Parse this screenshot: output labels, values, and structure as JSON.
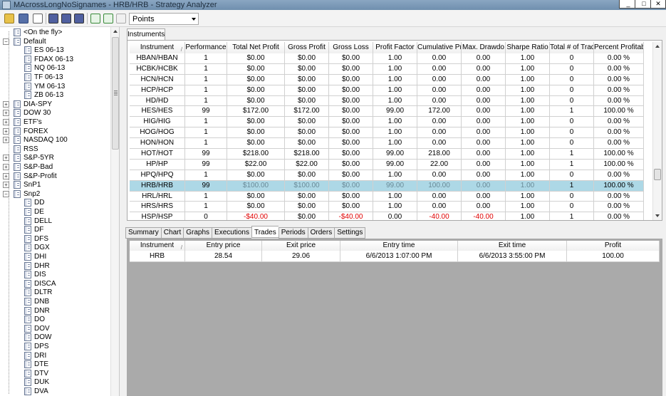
{
  "window": {
    "title": "MAcrossLongNoSignames - HRB/HRB - Strategy Analyzer",
    "minimize": "_",
    "maximize": "□",
    "close": "✕"
  },
  "toolbar": {
    "buttons": [
      "open-icon",
      "save-icon",
      "chat-icon",
      "backtest-icon",
      "optimize-icon",
      "walkforward-icon",
      "add-icon",
      "edit-icon",
      "remove-icon"
    ],
    "display_unit": "Points"
  },
  "tree": {
    "items": [
      {
        "label": "<On the fly>",
        "level": 1
      },
      {
        "label": "Default",
        "level": 0,
        "expander": "−"
      },
      {
        "label": "ES 06-13",
        "level": 2
      },
      {
        "label": "FDAX 06-13",
        "level": 2
      },
      {
        "label": "NQ 06-13",
        "level": 2
      },
      {
        "label": "TF 06-13",
        "level": 2
      },
      {
        "label": "YM 06-13",
        "level": 2
      },
      {
        "label": "ZB 06-13",
        "level": 2
      },
      {
        "label": "DIA-SPY",
        "level": 0,
        "expander": "+"
      },
      {
        "label": "DOW 30",
        "level": 0,
        "expander": "+"
      },
      {
        "label": "ETF's",
        "level": 0,
        "expander": "+"
      },
      {
        "label": "FOREX",
        "level": 0,
        "expander": "+"
      },
      {
        "label": "NASDAQ 100",
        "level": 0,
        "expander": "+"
      },
      {
        "label": "RSS",
        "level": 1
      },
      {
        "label": "S&P-5YR",
        "level": 0,
        "expander": "+"
      },
      {
        "label": "S&P-Bad",
        "level": 0,
        "expander": "+"
      },
      {
        "label": "S&P-Profit",
        "level": 0,
        "expander": "+"
      },
      {
        "label": "SnP1",
        "level": 0,
        "expander": "+"
      },
      {
        "label": "Snp2",
        "level": 0,
        "expander": "−"
      },
      {
        "label": "DD",
        "level": 2
      },
      {
        "label": "DE",
        "level": 2
      },
      {
        "label": "DELL",
        "level": 2
      },
      {
        "label": "DF",
        "level": 2
      },
      {
        "label": "DFS",
        "level": 2
      },
      {
        "label": "DGX",
        "level": 2
      },
      {
        "label": "DHI",
        "level": 2
      },
      {
        "label": "DHR",
        "level": 2
      },
      {
        "label": "DIS",
        "level": 2
      },
      {
        "label": "DISCA",
        "level": 2
      },
      {
        "label": "DLTR",
        "level": 2
      },
      {
        "label": "DNB",
        "level": 2
      },
      {
        "label": "DNR",
        "level": 2
      },
      {
        "label": "DO",
        "level": 2
      },
      {
        "label": "DOV",
        "level": 2
      },
      {
        "label": "DOW",
        "level": 2
      },
      {
        "label": "DPS",
        "level": 2
      },
      {
        "label": "DRI",
        "level": 2
      },
      {
        "label": "DTE",
        "level": 2
      },
      {
        "label": "DTV",
        "level": 2
      },
      {
        "label": "DUK",
        "level": 2
      },
      {
        "label": "DVA",
        "level": 2
      }
    ]
  },
  "instruments_tab": "Instruments",
  "grid": {
    "columns": [
      "Instrument",
      "Performance",
      "Total Net Profit",
      "Gross Profit",
      "Gross Loss",
      "Profit Factor",
      "Cumulative Pr",
      "Max. Drawdo",
      "Sharpe Ratio",
      "Total # of Trad",
      "Percent Profitabl"
    ],
    "sort_indicator": "/",
    "rows": [
      [
        "HBAN/HBAN",
        "1",
        "$0.00",
        "$0.00",
        "$0.00",
        "1.00",
        "0.00",
        "0.00",
        "1.00",
        "0",
        "0.00 %"
      ],
      [
        "HCBK/HCBK",
        "1",
        "$0.00",
        "$0.00",
        "$0.00",
        "1.00",
        "0.00",
        "0.00",
        "1.00",
        "0",
        "0.00 %"
      ],
      [
        "HCN/HCN",
        "1",
        "$0.00",
        "$0.00",
        "$0.00",
        "1.00",
        "0.00",
        "0.00",
        "1.00",
        "0",
        "0.00 %"
      ],
      [
        "HCP/HCP",
        "1",
        "$0.00",
        "$0.00",
        "$0.00",
        "1.00",
        "0.00",
        "0.00",
        "1.00",
        "0",
        "0.00 %"
      ],
      [
        "HD/HD",
        "1",
        "$0.00",
        "$0.00",
        "$0.00",
        "1.00",
        "0.00",
        "0.00",
        "1.00",
        "0",
        "0.00 %"
      ],
      [
        "HES/HES",
        "99",
        "$172.00",
        "$172.00",
        "$0.00",
        "99.00",
        "172.00",
        "0.00",
        "1.00",
        "1",
        "100.00 %"
      ],
      [
        "HIG/HIG",
        "1",
        "$0.00",
        "$0.00",
        "$0.00",
        "1.00",
        "0.00",
        "0.00",
        "1.00",
        "0",
        "0.00 %"
      ],
      [
        "HOG/HOG",
        "1",
        "$0.00",
        "$0.00",
        "$0.00",
        "1.00",
        "0.00",
        "0.00",
        "1.00",
        "0",
        "0.00 %"
      ],
      [
        "HON/HON",
        "1",
        "$0.00",
        "$0.00",
        "$0.00",
        "1.00",
        "0.00",
        "0.00",
        "1.00",
        "0",
        "0.00 %"
      ],
      [
        "HOT/HOT",
        "99",
        "$218.00",
        "$218.00",
        "$0.00",
        "99.00",
        "218.00",
        "0.00",
        "1.00",
        "1",
        "100.00 %"
      ],
      [
        "HP/HP",
        "99",
        "$22.00",
        "$22.00",
        "$0.00",
        "99.00",
        "22.00",
        "0.00",
        "1.00",
        "1",
        "100.00 %"
      ],
      [
        "HPQ/HPQ",
        "1",
        "$0.00",
        "$0.00",
        "$0.00",
        "1.00",
        "0.00",
        "0.00",
        "1.00",
        "0",
        "0.00 %"
      ],
      [
        "HRB/HRB",
        "99",
        "$100.00",
        "$100.00",
        "$0.00",
        "99.00",
        "100.00",
        "0.00",
        "1.00",
        "1",
        "100.00 %"
      ],
      [
        "HRL/HRL",
        "1",
        "$0.00",
        "$0.00",
        "$0.00",
        "1.00",
        "0.00",
        "0.00",
        "1.00",
        "0",
        "0.00 %"
      ],
      [
        "HRS/HRS",
        "1",
        "$0.00",
        "$0.00",
        "$0.00",
        "1.00",
        "0.00",
        "0.00",
        "1.00",
        "0",
        "0.00 %"
      ],
      [
        "HSP/HSP",
        "0",
        "-$40.00",
        "$0.00",
        "-$40.00",
        "0.00",
        "-40.00",
        "-40.00",
        "1.00",
        "1",
        "0.00 %"
      ]
    ],
    "selected_row": 12
  },
  "bottom_tabs": [
    "Summary",
    "Chart",
    "Graphs",
    "Executions",
    "Trades",
    "Periods",
    "Orders",
    "Settings"
  ],
  "active_bottom_tab": "Trades",
  "trades": {
    "columns": [
      "Instrument",
      "Entry price",
      "Exit price",
      "Entry time",
      "Exit time",
      "Profit"
    ],
    "sort_indicator": "/",
    "rows": [
      [
        "HRB",
        "28.54",
        "29.06",
        "6/6/2013 1:07:00 PM",
        "6/6/2013 3:55:00 PM",
        "100.00"
      ]
    ]
  }
}
